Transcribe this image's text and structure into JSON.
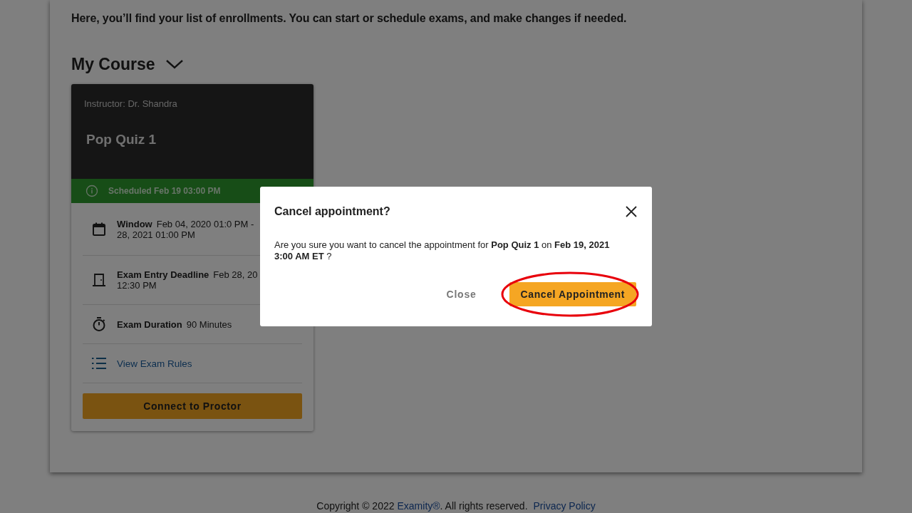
{
  "intro": "Here, you’ll find your list of enrollments. You can start or schedule exams, and make changes if needed.",
  "course_section": {
    "title": "My Course",
    "expanded": true
  },
  "exam_card": {
    "instructor": "Instructor: Dr. Shandra",
    "title": "Pop Quiz 1",
    "status": "Scheduled Feb 19 03:00 PM",
    "details": [
      {
        "kind": "window",
        "label": "Window",
        "lines": [
          "Feb 04, 2020 01:0 PM -",
          "28, 2021 01:00 PM"
        ]
      },
      {
        "kind": "deadline",
        "label": "Exam Entry Deadline",
        "lines": [
          "Feb 28, 20",
          "12:30 PM"
        ]
      },
      {
        "kind": "duration",
        "label": "Exam Duration",
        "lines": [
          "90 Minutes"
        ]
      },
      {
        "kind": "link",
        "label": "View Exam Rules"
      }
    ],
    "button": "Connect to Proctor"
  },
  "dialog": {
    "title": "Cancel appointment?",
    "message": "Are you sure you want to cancel the appointment for **Pop Quiz 1** on **Feb 19, 2021 3:00 AM ET** ?",
    "buttons": [
      {
        "label": "Close",
        "kind": "text"
      },
      {
        "label": "Cancel Appointment",
        "kind": "primary",
        "highlighted": true
      }
    ]
  },
  "footer": {
    "copyright": "Copyright © 2022",
    "brand_link": "Examity®",
    "rights": ". All rights reserved.",
    "privacy_link": "Privacy Policy"
  }
}
